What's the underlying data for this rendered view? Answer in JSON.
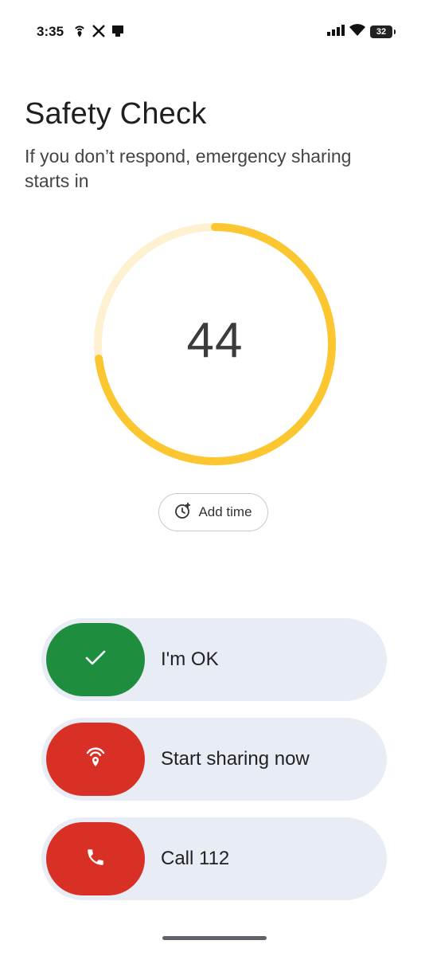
{
  "status_bar": {
    "time": "3:35",
    "battery": "32",
    "left_icons": [
      "location-broadcast-icon",
      "x-app-icon",
      "sim-icon"
    ],
    "right_icons": [
      "signal-icon",
      "wifi-icon",
      "battery-icon"
    ]
  },
  "header": {
    "title": "Safety Check",
    "subtitle": "If you don’t respond, emergency sharing starts in"
  },
  "countdown": {
    "value": "44",
    "remaining_fraction": 0.73,
    "color": "#fbc62f",
    "track_color": "#fdf1d2"
  },
  "add_time": {
    "label": "Add time",
    "icon": "timer-add-icon"
  },
  "actions": [
    {
      "label": "I'm OK",
      "icon": "check-icon",
      "color": "#1e8e3e"
    },
    {
      "label": "Start sharing now",
      "icon": "location-share-icon",
      "color": "#d93025"
    },
    {
      "label": "Call 112",
      "icon": "phone-icon",
      "color": "#d93025"
    }
  ]
}
